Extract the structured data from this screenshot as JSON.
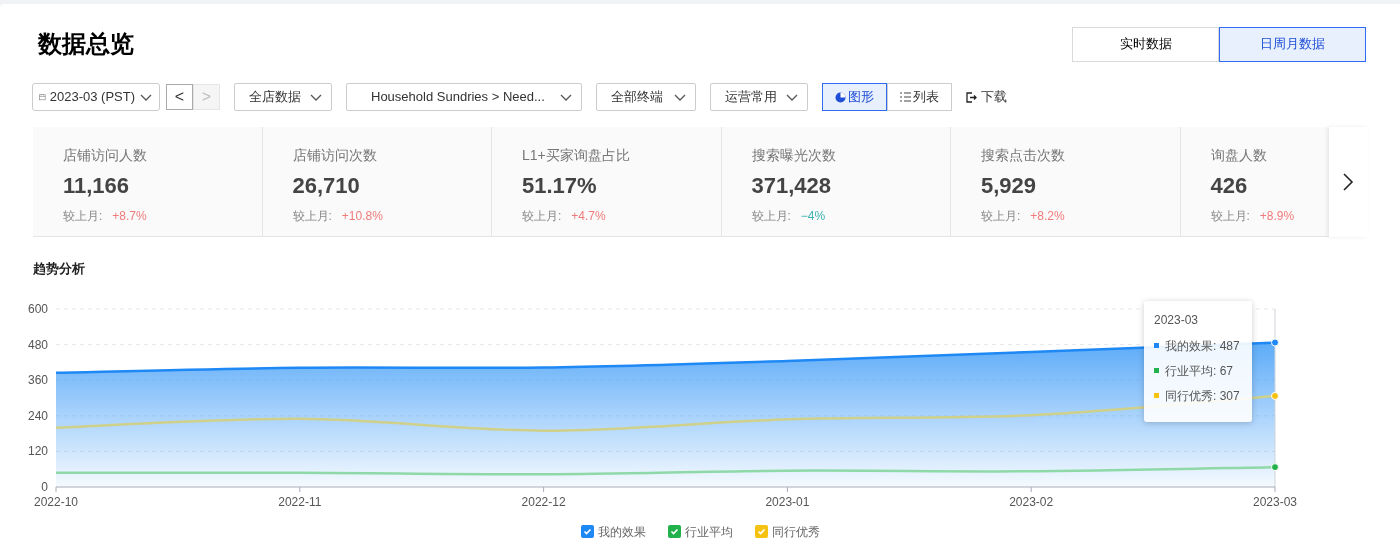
{
  "title": "数据总览",
  "view_tabs": [
    {
      "label": "实时数据",
      "selected": false
    },
    {
      "label": "日周月数据",
      "selected": true
    }
  ],
  "filters": {
    "date": "2023-03 (PST)",
    "prev": {
      "label": "<",
      "disabled": false
    },
    "next": {
      "label": ">",
      "disabled": true
    },
    "dropdowns": [
      "全店数据",
      "Household Sundries > Need...",
      "全部终端",
      "运营常用"
    ],
    "display_modes": [
      {
        "label": "图形",
        "kind": "chart",
        "selected": true
      },
      {
        "label": "列表",
        "kind": "list",
        "selected": false
      }
    ],
    "download": "下载"
  },
  "metrics": [
    {
      "label": "店铺访问人数",
      "value": "11,166",
      "compare_label": "较上月:",
      "change": "+8.7%",
      "color": "#f07a7a"
    },
    {
      "label": "店铺访问次数",
      "value": "26,710",
      "compare_label": "较上月:",
      "change": "+10.8%",
      "color": "#f07a7a"
    },
    {
      "label": "L1+买家询盘占比",
      "value": "51.17%",
      "compare_label": "较上月:",
      "change": "+4.7%",
      "color": "#f07a7a"
    },
    {
      "label": "搜索曝光次数",
      "value": "371,428",
      "compare_label": "较上月:",
      "change": "−4%",
      "color": "#3fb1b1"
    },
    {
      "label": "搜索点击次数",
      "value": "5,929",
      "compare_label": "较上月:",
      "change": "+8.2%",
      "color": "#f07a7a"
    },
    {
      "label": "询盘人数",
      "value": "426",
      "compare_label": "较上月:",
      "change": "+8.9%",
      "color": "#f07a7a"
    }
  ],
  "trend": {
    "title": "趋势分析",
    "chart_data": {
      "type": "line",
      "grid": true,
      "categories": [
        "2022-10",
        "2022-11",
        "2022-12",
        "2023-01",
        "2023-02",
        "2023-03"
      ],
      "ylim": [
        0,
        600
      ],
      "yticks": [
        0,
        120,
        240,
        360,
        480,
        600
      ],
      "series": [
        {
          "name": "我的效果",
          "color": "#1e88f5",
          "type": "area",
          "values": [
            385,
            402,
            403,
            425,
            455,
            487
          ]
        },
        {
          "name": "行业平均",
          "color": "#8fd9a8",
          "type": "line",
          "values": [
            48,
            48,
            43,
            55,
            53,
            67
          ]
        },
        {
          "name": "同行优秀",
          "color": "#cfd08a",
          "type": "line",
          "values": [
            200,
            230,
            190,
            228,
            242,
            307
          ]
        }
      ]
    },
    "legend": [
      {
        "checked": true,
        "color": "#1e88f5"
      },
      {
        "checked": true,
        "color": "#22b24c"
      },
      {
        "checked": true,
        "color": "#f5c211"
      }
    ],
    "tooltip": {
      "title": "2023-03",
      "rows": [
        {
          "text": "我的效果: 487",
          "color": "#1e88f5"
        },
        {
          "text": "行业平均: 67",
          "color": "#22b24c"
        },
        {
          "text": "同行优秀: 307",
          "color": "#f5c211"
        }
      ]
    }
  }
}
